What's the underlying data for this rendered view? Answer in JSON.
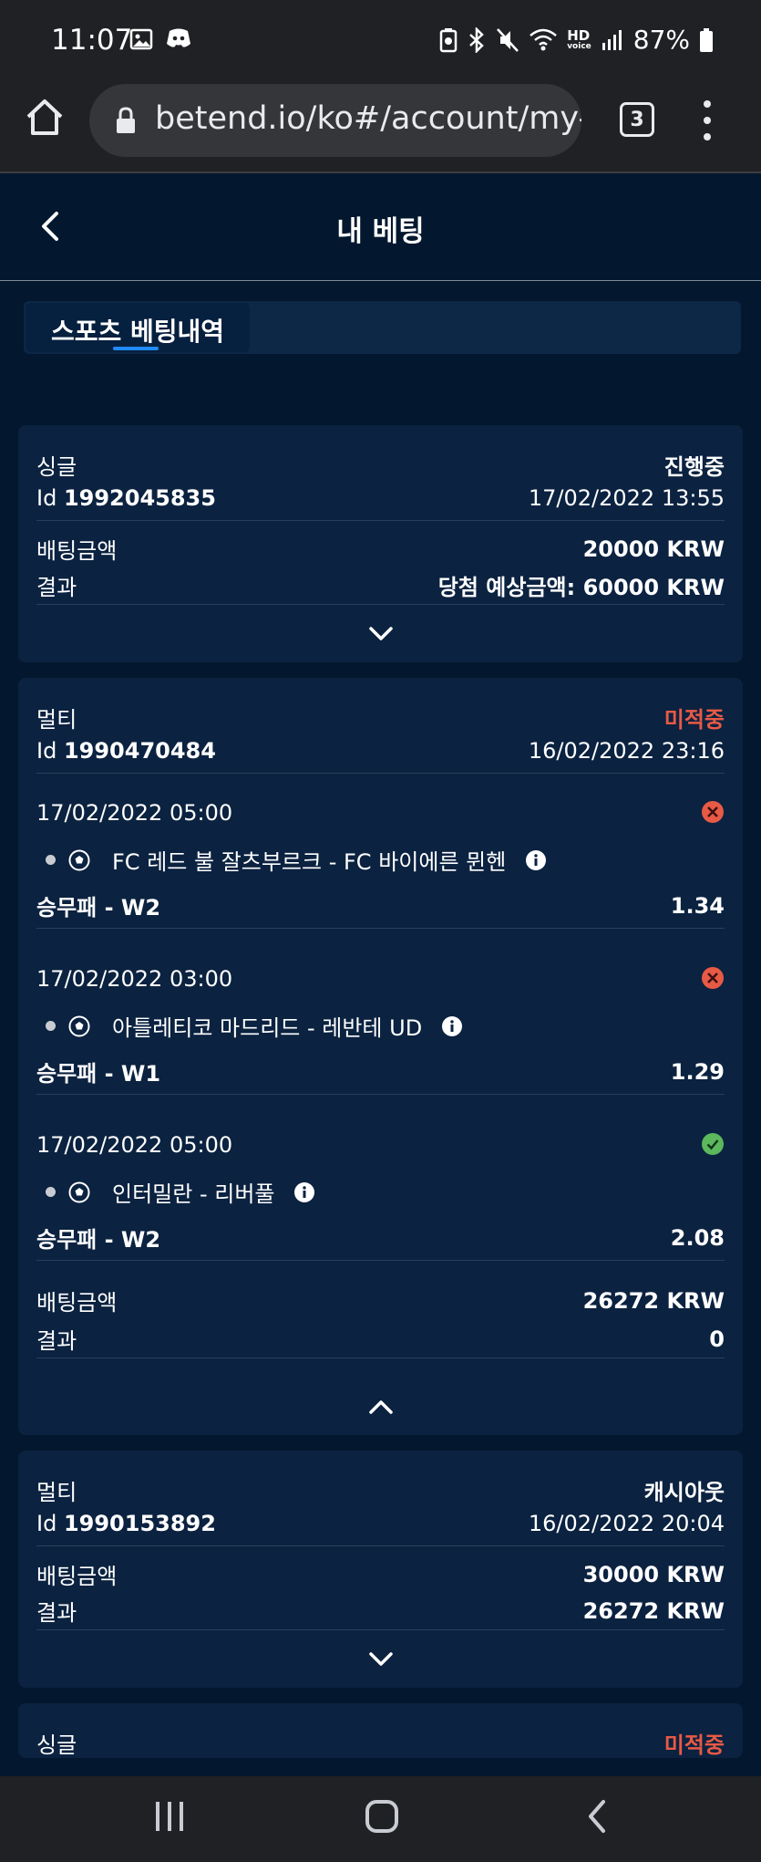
{
  "status_bar": {
    "time": "11:07",
    "battery": "87%",
    "hd_label": "HD",
    "voice_label": "voice"
  },
  "browser": {
    "url": "betend.io/ko#/account/my-b",
    "tab_count": "3"
  },
  "header": {
    "title": "내 베팅"
  },
  "tabs": [
    {
      "label": "스포츠 베팅내역"
    }
  ],
  "bets": [
    {
      "type": "싱글",
      "status": "진행중",
      "id_prefix": "Id",
      "id": "1992045835",
      "datetime": "17/02/2022 13:55",
      "stake_label": "배팅금액",
      "stake": "20000 KRW",
      "result_label": "결과",
      "result": "당첨 예상금액: 60000 KRW"
    },
    {
      "type": "멀티",
      "status": "미적중",
      "id_prefix": "Id",
      "id": "1990470484",
      "datetime": "16/02/2022 23:16",
      "legs": [
        {
          "datetime": "17/02/2022 05:00",
          "match": "FC 레드 불 잘츠부르크 - FC 바이에른 뮌헨",
          "market": "승무패 - W2",
          "odds": "1.34",
          "state": "lost"
        },
        {
          "datetime": "17/02/2022 03:00",
          "match": "아틀레티코 마드리드 - 레반테 UD",
          "market": "승무패 - W1",
          "odds": "1.29",
          "state": "lost"
        },
        {
          "datetime": "17/02/2022 05:00",
          "match": "인터밀란 - 리버풀",
          "market": "승무패 - W2",
          "odds": "2.08",
          "state": "won"
        }
      ],
      "stake_label": "배팅금액",
      "stake": "26272 KRW",
      "result_label": "결과",
      "result": "0"
    },
    {
      "type": "멀티",
      "status": "캐시아웃",
      "id_prefix": "Id",
      "id": "1990153892",
      "datetime": "16/02/2022 20:04",
      "stake_label": "배팅금액",
      "stake": "30000 KRW",
      "result_label": "결과",
      "result": "26272 KRW"
    },
    {
      "type": "싱글",
      "status": "미적중"
    }
  ],
  "colors": {
    "background": "#03182e",
    "card": "#0b2240",
    "lost": "#e85a45",
    "won": "#5cb85c",
    "accent": "#1f8bff"
  }
}
